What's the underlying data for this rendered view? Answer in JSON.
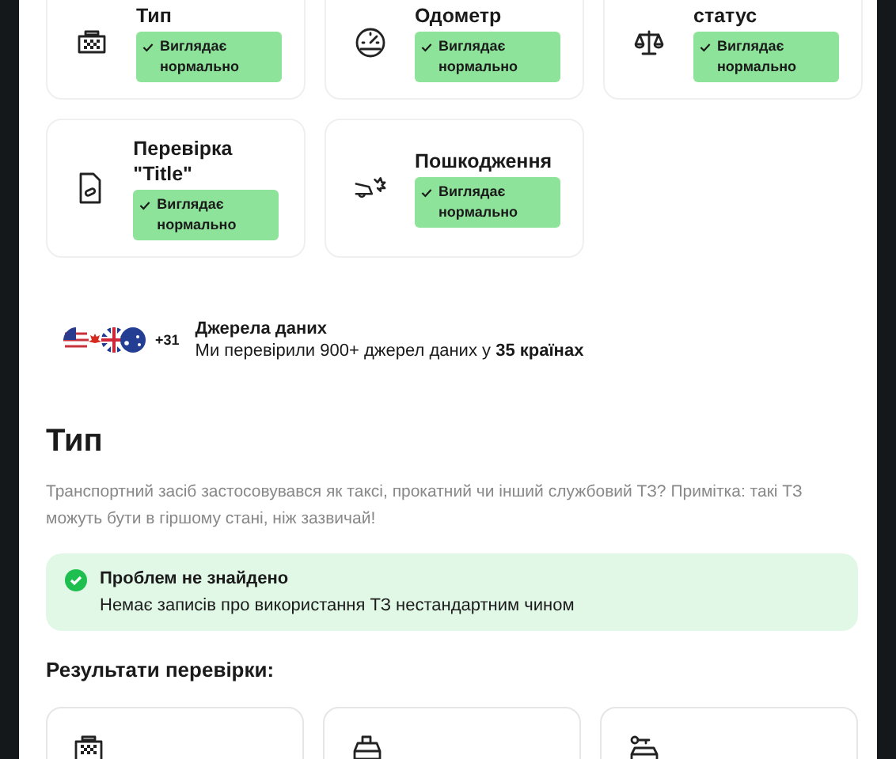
{
  "checks": [
    {
      "kind": "type",
      "title": "Тип",
      "passed": true,
      "badge": "Виглядає нормально"
    },
    {
      "kind": "odometer",
      "title": "Одометр",
      "passed": true,
      "badge": "Виглядає нормально"
    },
    {
      "kind": "legal",
      "title": "статус",
      "passed": true,
      "badge": "Виглядає нормально"
    },
    {
      "kind": "title",
      "title": "Перевірка \"Title\"",
      "passed": true,
      "badge": "Виглядає нормально"
    },
    {
      "kind": "damage",
      "title": "Пошкодження",
      "passed": true,
      "badge": "Виглядає нормально"
    }
  ],
  "sources": {
    "more": "+31",
    "title": "Джерела даних",
    "text": "Ми перевірили 900+ джерел даних у **35 країнах**"
  },
  "section": {
    "heading": "Тип",
    "description": "Транспортний засіб застосовувався як таксі, прокатний чи інший службовий ТЗ? Примітка: такі ТЗ можуть бути в гіршому стані, ніж зазвичай!",
    "alert": {
      "passed": true,
      "title": "Проблем не знайдено",
      "text": "Немає записів про використання ТЗ нестандартним чином"
    },
    "results_heading": "Результати перевірки:",
    "results": [
      {
        "kind": "taxi"
      },
      {
        "kind": "rental"
      },
      {
        "kind": "service"
      }
    ]
  }
}
